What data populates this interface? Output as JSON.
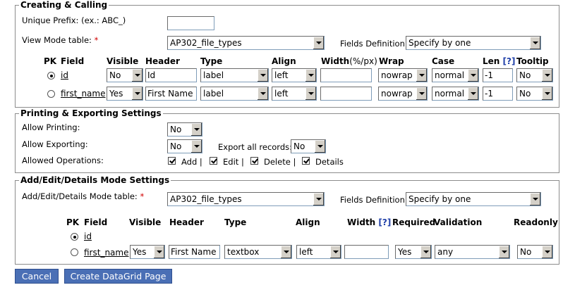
{
  "creating": {
    "legend": "Creating & Calling",
    "unique_prefix_label": "Unique Prefix: (ex.: ABC_)",
    "unique_prefix_value": "",
    "view_mode_label": "View Mode table:",
    "required_mark": "*",
    "view_mode_table": "AP302_file_types",
    "fields_def_label": "Fields Definition:",
    "fields_def_value": "Specify by one",
    "headers": {
      "pk": "PK",
      "field": "Field",
      "visible": "Visible",
      "header": "Header",
      "type": "Type",
      "align": "Align",
      "width": "Width",
      "width_unit": "(%/px)",
      "wrap": "Wrap",
      "case": "Case",
      "len": "Len",
      "help": "[?]",
      "tooltip": "Tooltip"
    },
    "rows": [
      {
        "field": "id",
        "visible": "No",
        "header": "Id",
        "type": "label",
        "align": "left",
        "width": "",
        "wrap": "nowrap",
        "case": "normal",
        "len": "-1",
        "tooltip": "No"
      },
      {
        "field": "first_name",
        "visible": "Yes",
        "header": "First Name",
        "type": "label",
        "align": "left",
        "width": "",
        "wrap": "nowrap",
        "case": "normal",
        "len": "-1",
        "tooltip": "No"
      }
    ]
  },
  "printing": {
    "legend": "Printing & Exporting Settings",
    "allow_printing_label": "Allow Printing:",
    "allow_printing_value": "No",
    "allow_exporting_label": "Allow Exporting:",
    "allow_exporting_value": "No",
    "export_all_label": "Export all records:",
    "export_all_value": "No",
    "allowed_ops_label": "Allowed Operations:",
    "ops": [
      {
        "label": "Add",
        "sep": "|"
      },
      {
        "label": "Edit",
        "sep": "|"
      },
      {
        "label": "Delete",
        "sep": "|"
      },
      {
        "label": "Details",
        "sep": ""
      }
    ]
  },
  "addedit": {
    "legend": "Add/Edit/Details Mode Settings",
    "table_label": "Add/Edit/Details Mode table:",
    "required_mark": "*",
    "table_value": "AP302_file_types",
    "fields_def_label": "Fields Definition:",
    "fields_def_value": "Specify by one",
    "headers": {
      "pk": "PK",
      "field": "Field",
      "visible": "Visible",
      "header": "Header",
      "type": "Type",
      "align": "Align",
      "width": "Width",
      "help": "[?]",
      "required": "Required",
      "validation": "Validation",
      "readonly": "Readonly"
    },
    "rows": [
      {
        "field": "id"
      },
      {
        "field": "first_name",
        "visible": "Yes",
        "header": "First Name",
        "type": "textbox",
        "align": "left",
        "width": "",
        "required": "Yes",
        "validation": "any",
        "readonly": "No"
      }
    ]
  },
  "buttons": {
    "cancel": "Cancel",
    "create": "Create DataGrid Page"
  }
}
